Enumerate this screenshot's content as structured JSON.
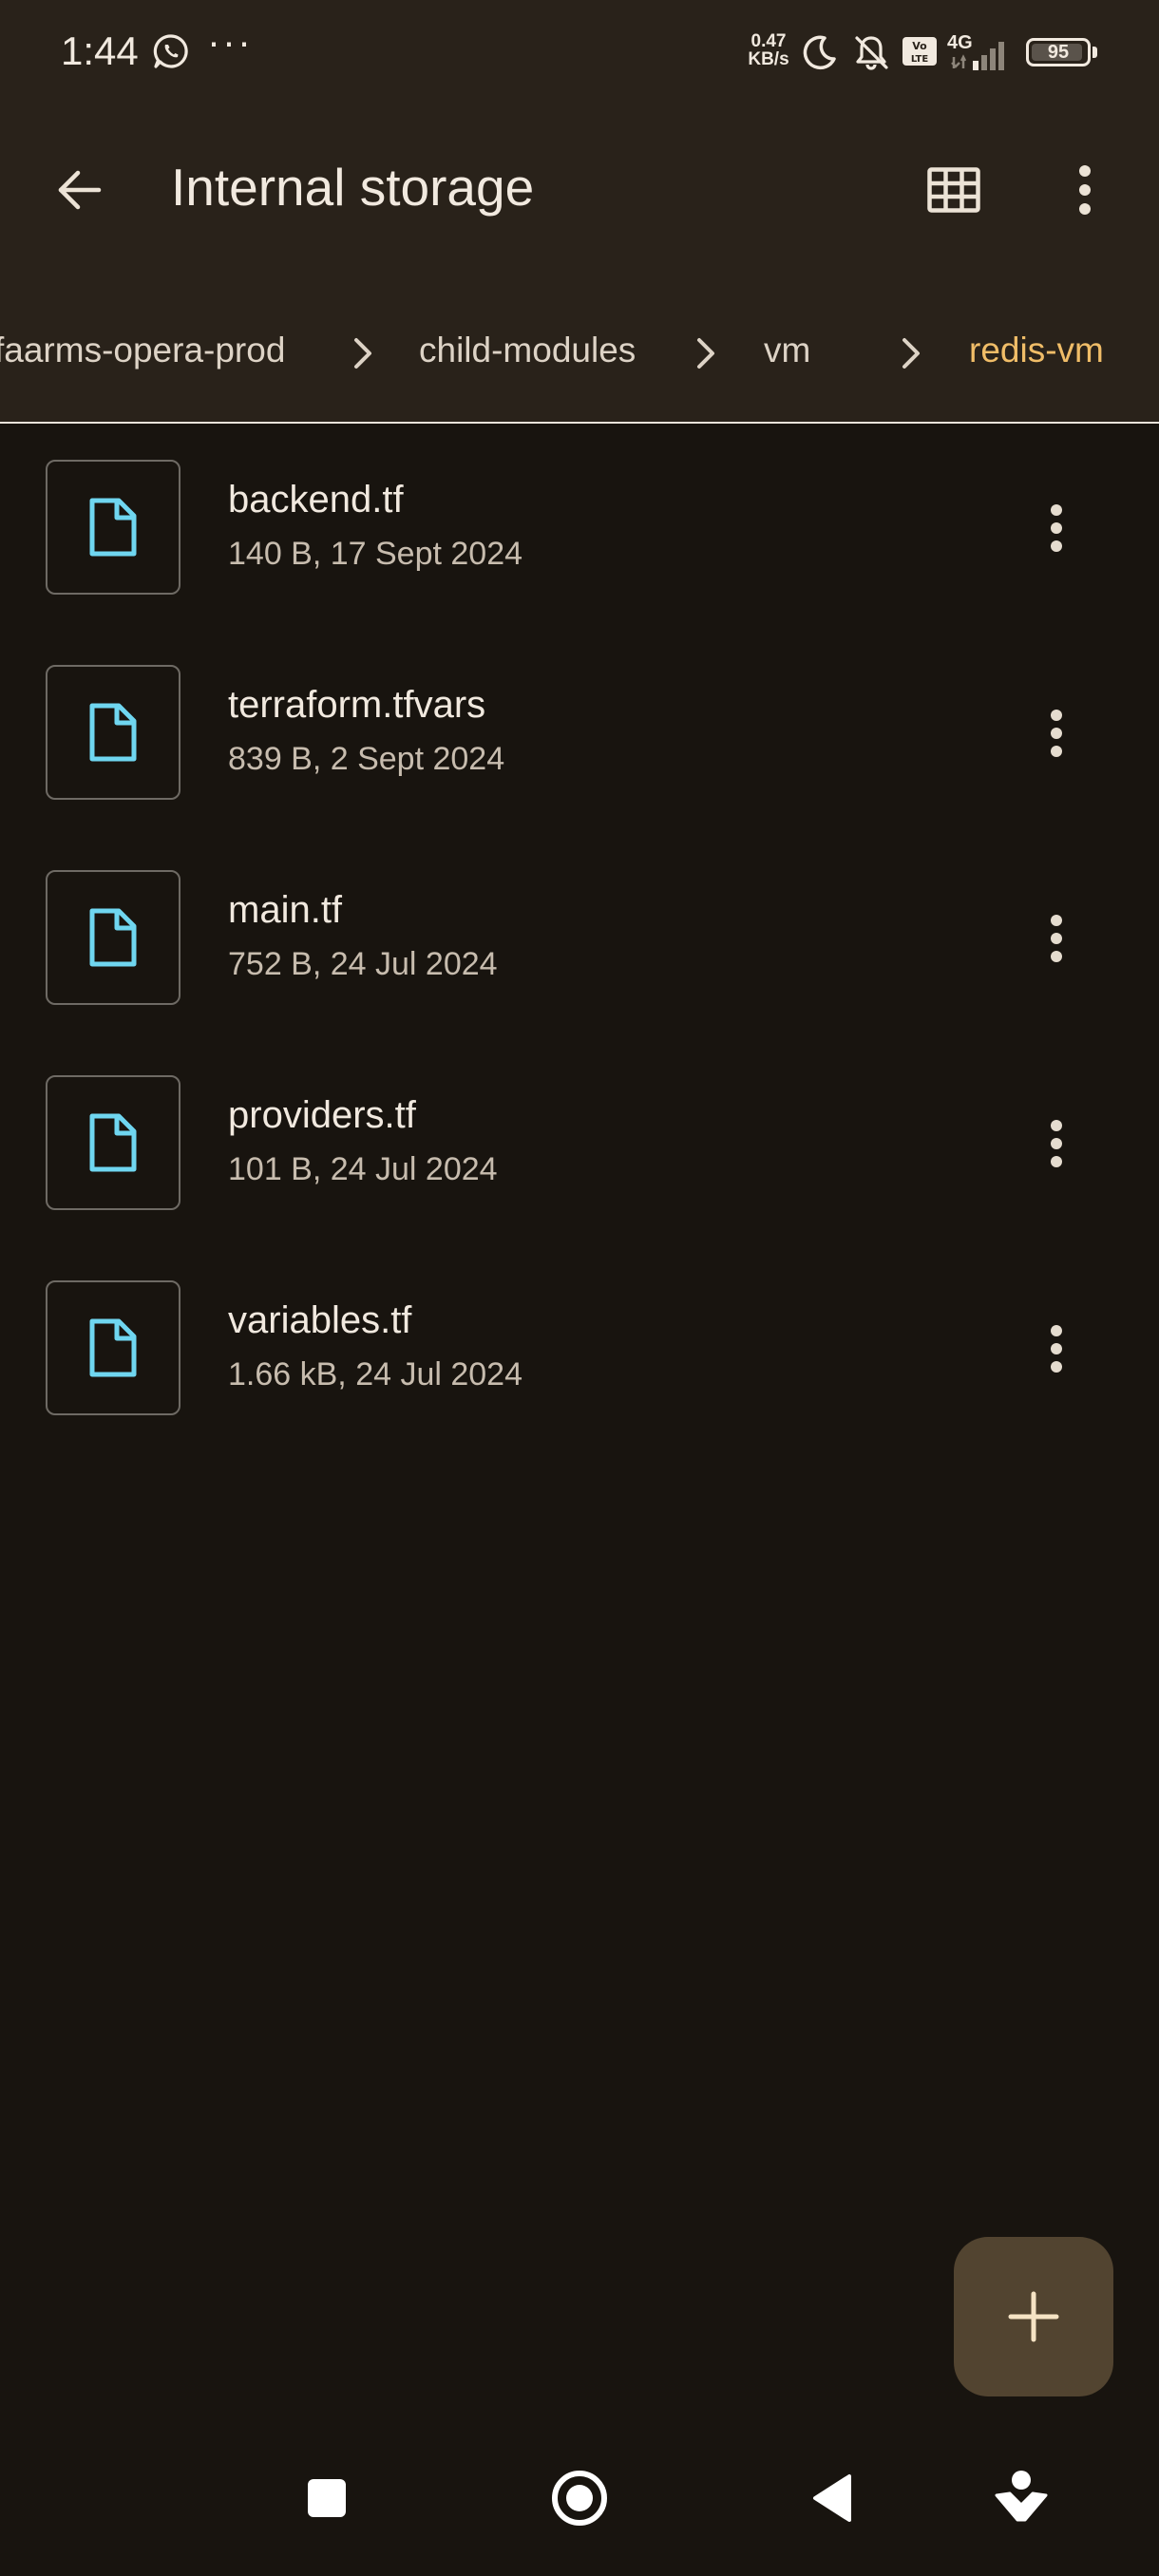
{
  "status_bar": {
    "time": "1:44",
    "overflow_dots": "···",
    "network_speed_value": "0.47",
    "network_speed_unit": "KB/s",
    "network_type": "4G",
    "battery_level": "95",
    "icons": [
      "whatsapp-icon",
      "moon-icon",
      "bell-off-icon",
      "volte-icon",
      "signal-icon",
      "battery-icon"
    ]
  },
  "app_bar": {
    "title": "Internal storage",
    "icons": [
      "back-arrow-icon",
      "grid-view-icon",
      "more-vert-icon"
    ]
  },
  "breadcrumbs": [
    {
      "label": "faarms-opera-prod",
      "active": false
    },
    {
      "label": "child-modules",
      "active": false
    },
    {
      "label": "vm",
      "active": false
    },
    {
      "label": "redis-vm",
      "active": true
    }
  ],
  "files": [
    {
      "name": "backend.tf",
      "meta": "140 B, 17 Sept 2024"
    },
    {
      "name": "terraform.tfvars",
      "meta": "839 B, 2 Sept 2024"
    },
    {
      "name": "main.tf",
      "meta": "752 B, 24 Jul 2024"
    },
    {
      "name": "providers.tf",
      "meta": "101 B, 24 Jul 2024"
    },
    {
      "name": "variables.tf",
      "meta": "1.66 kB, 24 Jul 2024"
    }
  ],
  "fab": {
    "icon": "plus-icon"
  },
  "nav_bar": {
    "icons": [
      "recents-square-icon",
      "home-circle-icon",
      "back-triangle-icon",
      "assistant-icon"
    ]
  },
  "colors": {
    "background": "#18140f",
    "header_background": "#29221a",
    "active_breadcrumb": "#f0bd68",
    "file_icon": "#6fd6f0",
    "fab_background": "#524430"
  }
}
